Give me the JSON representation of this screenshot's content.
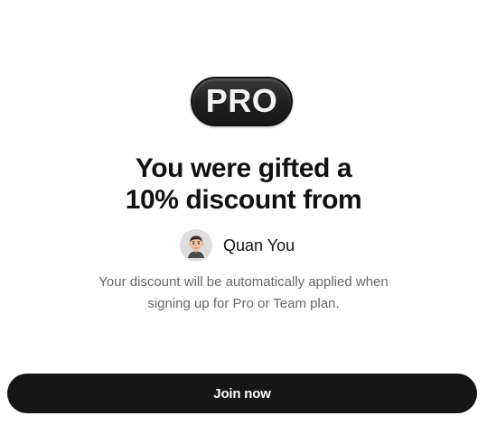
{
  "badge": {
    "label": "PRO"
  },
  "headline": {
    "line1": "You were gifted a",
    "line2": "10% discount from"
  },
  "giver": {
    "name": "Quan You",
    "avatar_icon": "person-memoji-icon"
  },
  "description": {
    "line1": "Your discount will be automatically applied when",
    "line2": "signing up for Pro or Team plan."
  },
  "cta": {
    "label": "Join now"
  },
  "colors": {
    "background": "#ffffff",
    "text_primary": "#111111",
    "text_secondary": "#666666",
    "button_bg": "#161616",
    "button_text": "#ffffff",
    "avatar_bg": "#dedede"
  }
}
